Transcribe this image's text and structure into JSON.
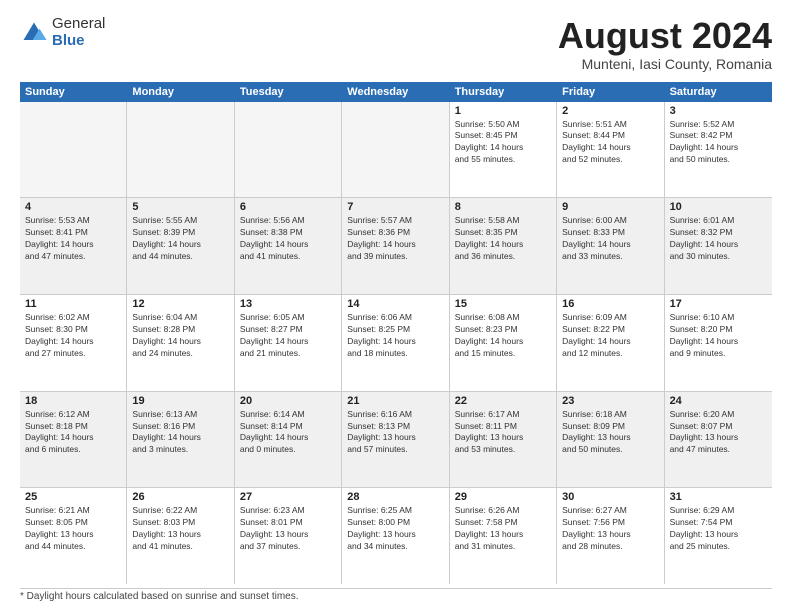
{
  "header": {
    "logo_general": "General",
    "logo_blue": "Blue",
    "month_title": "August 2024",
    "subtitle": "Munteni, Iasi County, Romania"
  },
  "weekdays": [
    "Sunday",
    "Monday",
    "Tuesday",
    "Wednesday",
    "Thursday",
    "Friday",
    "Saturday"
  ],
  "footer_note": "Daylight hours",
  "weeks": [
    [
      {
        "day": "",
        "empty": true
      },
      {
        "day": "",
        "empty": true
      },
      {
        "day": "",
        "empty": true
      },
      {
        "day": "",
        "empty": true
      },
      {
        "day": "1",
        "sunrise": "5:50 AM",
        "sunset": "8:45 PM",
        "daylight": "14 hours and 55 minutes."
      },
      {
        "day": "2",
        "sunrise": "5:51 AM",
        "sunset": "8:44 PM",
        "daylight": "14 hours and 52 minutes."
      },
      {
        "day": "3",
        "sunrise": "5:52 AM",
        "sunset": "8:42 PM",
        "daylight": "14 hours and 50 minutes."
      }
    ],
    [
      {
        "day": "4",
        "sunrise": "5:53 AM",
        "sunset": "8:41 PM",
        "daylight": "14 hours and 47 minutes."
      },
      {
        "day": "5",
        "sunrise": "5:55 AM",
        "sunset": "8:39 PM",
        "daylight": "14 hours and 44 minutes."
      },
      {
        "day": "6",
        "sunrise": "5:56 AM",
        "sunset": "8:38 PM",
        "daylight": "14 hours and 41 minutes."
      },
      {
        "day": "7",
        "sunrise": "5:57 AM",
        "sunset": "8:36 PM",
        "daylight": "14 hours and 39 minutes."
      },
      {
        "day": "8",
        "sunrise": "5:58 AM",
        "sunset": "8:35 PM",
        "daylight": "14 hours and 36 minutes."
      },
      {
        "day": "9",
        "sunrise": "6:00 AM",
        "sunset": "8:33 PM",
        "daylight": "14 hours and 33 minutes."
      },
      {
        "day": "10",
        "sunrise": "6:01 AM",
        "sunset": "8:32 PM",
        "daylight": "14 hours and 30 minutes."
      }
    ],
    [
      {
        "day": "11",
        "sunrise": "6:02 AM",
        "sunset": "8:30 PM",
        "daylight": "14 hours and 27 minutes."
      },
      {
        "day": "12",
        "sunrise": "6:04 AM",
        "sunset": "8:28 PM",
        "daylight": "14 hours and 24 minutes."
      },
      {
        "day": "13",
        "sunrise": "6:05 AM",
        "sunset": "8:27 PM",
        "daylight": "14 hours and 21 minutes."
      },
      {
        "day": "14",
        "sunrise": "6:06 AM",
        "sunset": "8:25 PM",
        "daylight": "14 hours and 18 minutes."
      },
      {
        "day": "15",
        "sunrise": "6:08 AM",
        "sunset": "8:23 PM",
        "daylight": "14 hours and 15 minutes."
      },
      {
        "day": "16",
        "sunrise": "6:09 AM",
        "sunset": "8:22 PM",
        "daylight": "14 hours and 12 minutes."
      },
      {
        "day": "17",
        "sunrise": "6:10 AM",
        "sunset": "8:20 PM",
        "daylight": "14 hours and 9 minutes."
      }
    ],
    [
      {
        "day": "18",
        "sunrise": "6:12 AM",
        "sunset": "8:18 PM",
        "daylight": "14 hours and 6 minutes."
      },
      {
        "day": "19",
        "sunrise": "6:13 AM",
        "sunset": "8:16 PM",
        "daylight": "14 hours and 3 minutes."
      },
      {
        "day": "20",
        "sunrise": "6:14 AM",
        "sunset": "8:14 PM",
        "daylight": "14 hours and 0 minutes."
      },
      {
        "day": "21",
        "sunrise": "6:16 AM",
        "sunset": "8:13 PM",
        "daylight": "13 hours and 57 minutes."
      },
      {
        "day": "22",
        "sunrise": "6:17 AM",
        "sunset": "8:11 PM",
        "daylight": "13 hours and 53 minutes."
      },
      {
        "day": "23",
        "sunrise": "6:18 AM",
        "sunset": "8:09 PM",
        "daylight": "13 hours and 50 minutes."
      },
      {
        "day": "24",
        "sunrise": "6:20 AM",
        "sunset": "8:07 PM",
        "daylight": "13 hours and 47 minutes."
      }
    ],
    [
      {
        "day": "25",
        "sunrise": "6:21 AM",
        "sunset": "8:05 PM",
        "daylight": "13 hours and 44 minutes."
      },
      {
        "day": "26",
        "sunrise": "6:22 AM",
        "sunset": "8:03 PM",
        "daylight": "13 hours and 41 minutes."
      },
      {
        "day": "27",
        "sunrise": "6:23 AM",
        "sunset": "8:01 PM",
        "daylight": "13 hours and 37 minutes."
      },
      {
        "day": "28",
        "sunrise": "6:25 AM",
        "sunset": "8:00 PM",
        "daylight": "13 hours and 34 minutes."
      },
      {
        "day": "29",
        "sunrise": "6:26 AM",
        "sunset": "7:58 PM",
        "daylight": "13 hours and 31 minutes."
      },
      {
        "day": "30",
        "sunrise": "6:27 AM",
        "sunset": "7:56 PM",
        "daylight": "13 hours and 28 minutes."
      },
      {
        "day": "31",
        "sunrise": "6:29 AM",
        "sunset": "7:54 PM",
        "daylight": "13 hours and 25 minutes."
      }
    ]
  ]
}
